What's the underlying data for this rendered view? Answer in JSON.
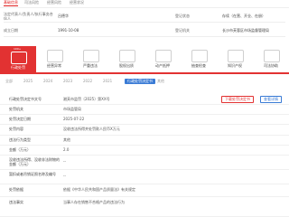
{
  "tabs": [
    {
      "label": "基础信息"
    },
    {
      "label": "司法风险"
    },
    {
      "label": "经营风险"
    },
    {
      "label": "经营状况"
    }
  ],
  "info": {
    "legal_rep_label": "法定代表人/负责人/执行事务合伙人",
    "legal_rep_value": "吕德华",
    "reg_status_label": "登记状态",
    "reg_status_value": "存续（在营、开业、在册）",
    "est_date_label": "成立日期",
    "est_date_value": "1991-10-08",
    "reg_authority_label": "登记机关",
    "reg_authority_value": "长沙市芙蓉区市场监督管理局"
  },
  "icon_bar": [
    {
      "label": "行政处罚",
      "badge": "100+",
      "active": true
    },
    {
      "label": "经营异常",
      "active": false
    },
    {
      "label": "严重违法",
      "active": false
    },
    {
      "label": "股权出质",
      "active": false
    },
    {
      "label": "动产抵押",
      "active": false
    },
    {
      "label": "抽查检查",
      "active": false
    },
    {
      "label": "知识产权",
      "active": false
    },
    {
      "label": "司法协助",
      "active": false
    }
  ],
  "filters": {
    "items": [
      "全部",
      "2025",
      "2024",
      "2023",
      "2022",
      "2021",
      "行政处罚决定书",
      "其他"
    ],
    "selected_index": 6
  },
  "detail": {
    "row1_label": "行政处罚决定书文号",
    "row1_value": "湘芙市监罚〔2025〕第XX号",
    "btn_notice": "下载处罚决定书",
    "btn_detail": "查看详情",
    "row2_label": "处罚机关",
    "row2_value": "市场监管局",
    "row3_label": "处罚决定日期",
    "row3_value": "2025-07-22",
    "row4_label": "处罚内容",
    "row4_value": "没收违法所得并处罚款人民币X万元",
    "row5_label": "违法行为类型",
    "row5_value": "其他",
    "row6_label": "金额（万元）",
    "row6_value": "2.0",
    "row7_label": "没收违法所得、没收非法财物的金额（万元）",
    "row7_value": "--",
    "row8_label": "暂扣或者吊销证照名称及编号",
    "row8_value": "--",
    "row9_label": "处罚依据",
    "row9_value": "依据《中华人民共和国产品质量法》有关规定",
    "row10_label": "违法事实",
    "row10_value": "当事人存在销售不合格产品的违法行为"
  },
  "colors": {
    "accent": "#e23232",
    "link": "#3a7bd5"
  }
}
